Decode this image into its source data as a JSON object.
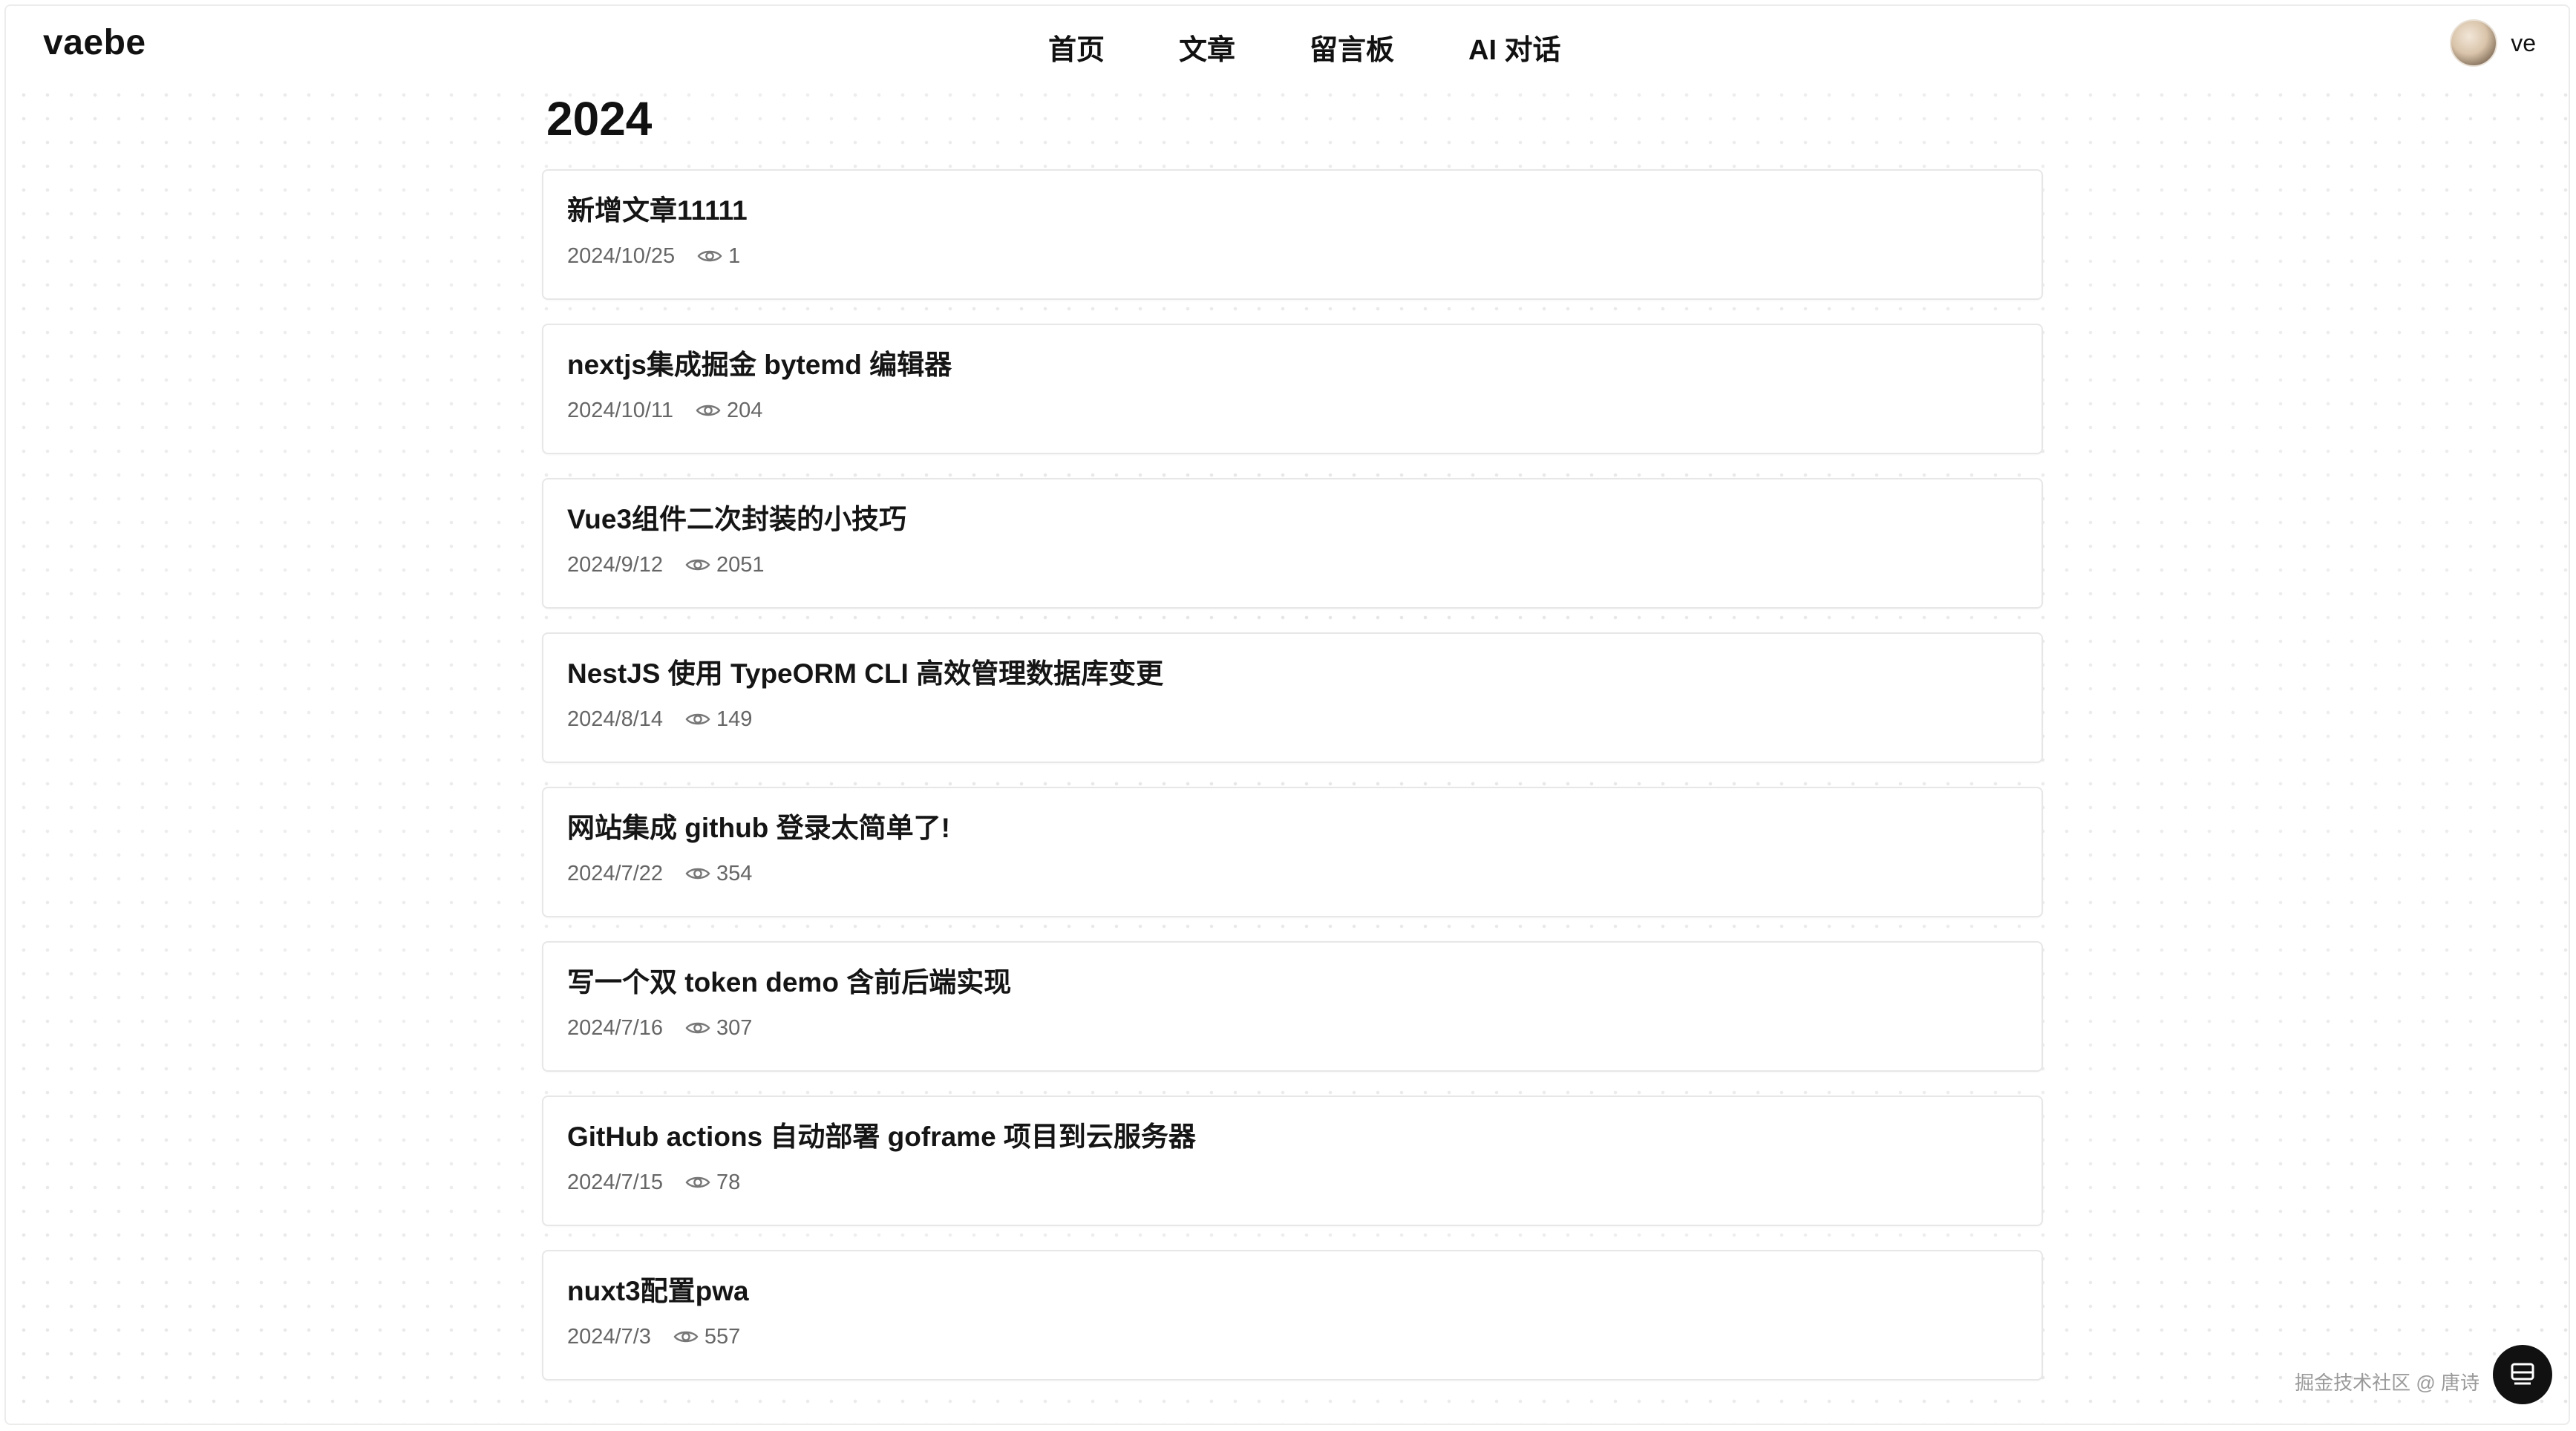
{
  "brand": {
    "name": "vaebe"
  },
  "nav": {
    "items": [
      {
        "label": "首页"
      },
      {
        "label": "文章"
      },
      {
        "label": "留言板"
      },
      {
        "label": "AI 对话"
      }
    ]
  },
  "user": {
    "name": "ve"
  },
  "archive": {
    "year": "2024",
    "articles": [
      {
        "title": "新增文章11111",
        "date": "2024/10/25",
        "views": "1"
      },
      {
        "title": "nextjs集成掘金 bytemd 编辑器",
        "date": "2024/10/11",
        "views": "204"
      },
      {
        "title": "Vue3组件二次封装的小技巧",
        "date": "2024/9/12",
        "views": "2051"
      },
      {
        "title": "NestJS 使用 TypeORM CLI 高效管理数据库变更",
        "date": "2024/8/14",
        "views": "149"
      },
      {
        "title": "网站集成 github 登录太简单了!",
        "date": "2024/7/22",
        "views": "354"
      },
      {
        "title": "写一个双 token demo 含前后端实现",
        "date": "2024/7/16",
        "views": "307"
      },
      {
        "title": "GitHub actions 自动部署 goframe 项目到云服务器",
        "date": "2024/7/15",
        "views": "78"
      },
      {
        "title": "nuxt3配置pwa",
        "date": "2024/7/3",
        "views": "557"
      }
    ]
  },
  "watermark": {
    "text": "掘金技术社区 @ 唐诗"
  },
  "icons": {
    "views": "eye-icon",
    "float": "message-box-icon"
  },
  "colors": {
    "text": "#111111",
    "meta": "#666666",
    "border": "#e7e7e7"
  }
}
